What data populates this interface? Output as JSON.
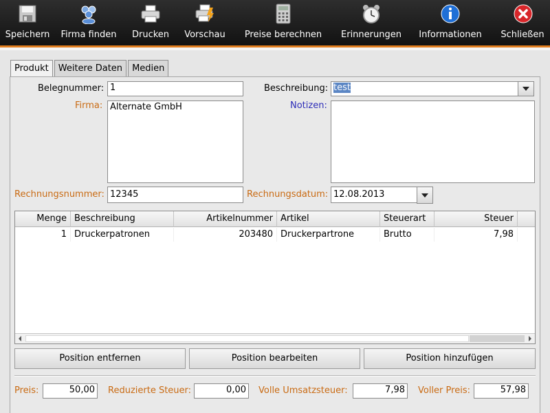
{
  "toolbar": {
    "items": [
      {
        "label": "Speichern",
        "icon": "save-icon"
      },
      {
        "label": "Firma finden",
        "icon": "users-icon"
      },
      {
        "label": "Drucken",
        "icon": "printer-icon"
      },
      {
        "label": "Vorschau",
        "icon": "print-preview-icon"
      },
      {
        "label": "Preise berechnen",
        "icon": "calculator-icon"
      },
      {
        "label": "Erinnerungen",
        "icon": "alarm-clock-icon"
      },
      {
        "label": "Informationen",
        "icon": "info-icon"
      },
      {
        "label": "Schließen",
        "icon": "close-icon"
      }
    ],
    "accent_color": "#e07d1e"
  },
  "tabs": [
    {
      "label": "Produkt",
      "active": true
    },
    {
      "label": "Weitere Daten",
      "active": false
    },
    {
      "label": "Medien",
      "active": false
    }
  ],
  "form": {
    "belegnummer_label": "Belegnummer:",
    "belegnummer_value": "1",
    "firma_label": "Firma:",
    "firma_value": "Alternate GmbH",
    "beschreibung_label": "Beschreibung:",
    "beschreibung_value": "test",
    "notizen_label": "Notizen:",
    "notizen_value": "",
    "rechnungsnummer_label": "Rechnungsnummer:",
    "rechnungsnummer_value": "12345",
    "rechnungsdatum_label": "Rechnungsdatum:",
    "rechnungsdatum_value": "12.08.2013"
  },
  "table": {
    "columns": [
      "Menge",
      "Beschreibung",
      "Artikelnummer",
      "Artikel",
      "Steuerart",
      "Steuer"
    ],
    "rows": [
      [
        "1",
        "Druckerpatronen",
        "203480",
        "Druckerpartrone",
        "Brutto",
        "7,98"
      ]
    ]
  },
  "buttons": {
    "remove": "Position entfernen",
    "edit": "Position bearbeiten",
    "add": "Position hinzufügen"
  },
  "totals": {
    "preis_label": "Preis:",
    "preis_value": "50,00",
    "reduziert_label": "Reduzierte Steuer:",
    "reduziert_value": "0,00",
    "voll_label": "Volle Umsatzsteuer:",
    "voll_value": "7,98",
    "voller_preis_label": "Voller Preis:",
    "voller_preis_value": "57,98"
  }
}
